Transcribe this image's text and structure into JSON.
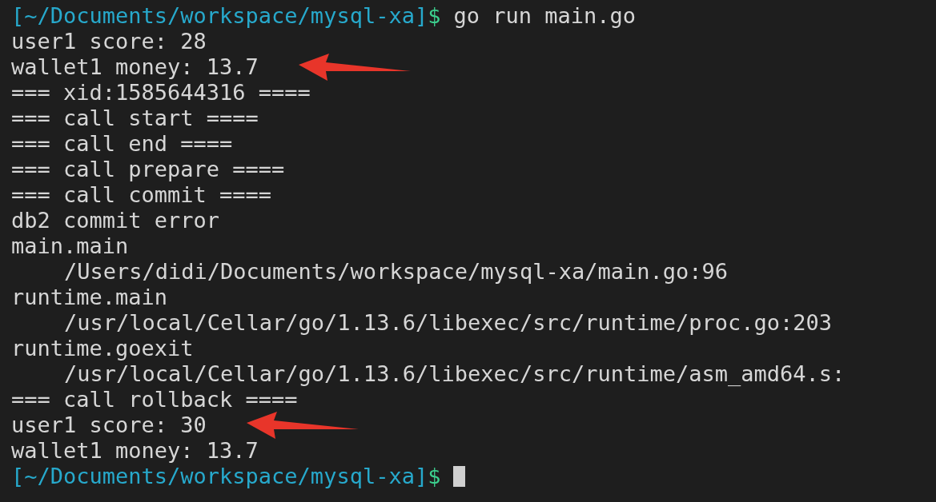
{
  "terminal": {
    "lines": [
      {
        "kind": "prompt",
        "path": "[~/Documents/workspace/mysql-xa]",
        "symbol": "$",
        "command": "go run main.go"
      },
      {
        "kind": "output",
        "text": "user1 score: 28"
      },
      {
        "kind": "output",
        "text": "wallet1 money: 13.7",
        "arrow": true
      },
      {
        "kind": "output",
        "text": "=== xid:1585644316 ===="
      },
      {
        "kind": "output",
        "text": "=== call start ===="
      },
      {
        "kind": "output",
        "text": "=== call end ===="
      },
      {
        "kind": "output",
        "text": "=== call prepare ===="
      },
      {
        "kind": "output",
        "text": "=== call commit ===="
      },
      {
        "kind": "output",
        "text": "db2 commit error"
      },
      {
        "kind": "output",
        "text": "main.main"
      },
      {
        "kind": "indented",
        "text": "/Users/didi/Documents/workspace/mysql-xa/main.go:96"
      },
      {
        "kind": "output",
        "text": "runtime.main"
      },
      {
        "kind": "indented",
        "text": "/usr/local/Cellar/go/1.13.6/libexec/src/runtime/proc.go:203"
      },
      {
        "kind": "output",
        "text": "runtime.goexit"
      },
      {
        "kind": "indented",
        "text": "/usr/local/Cellar/go/1.13.6/libexec/src/runtime/asm_amd64.s:"
      },
      {
        "kind": "output",
        "text": "=== call rollback ===="
      },
      {
        "kind": "output",
        "text": "user1 score: 30",
        "arrow": true
      },
      {
        "kind": "output",
        "text": "wallet1 money: 13.7"
      },
      {
        "kind": "prompt",
        "path": "[~/Documents/workspace/mysql-xa]",
        "symbol": "$",
        "cursor": true
      }
    ]
  }
}
